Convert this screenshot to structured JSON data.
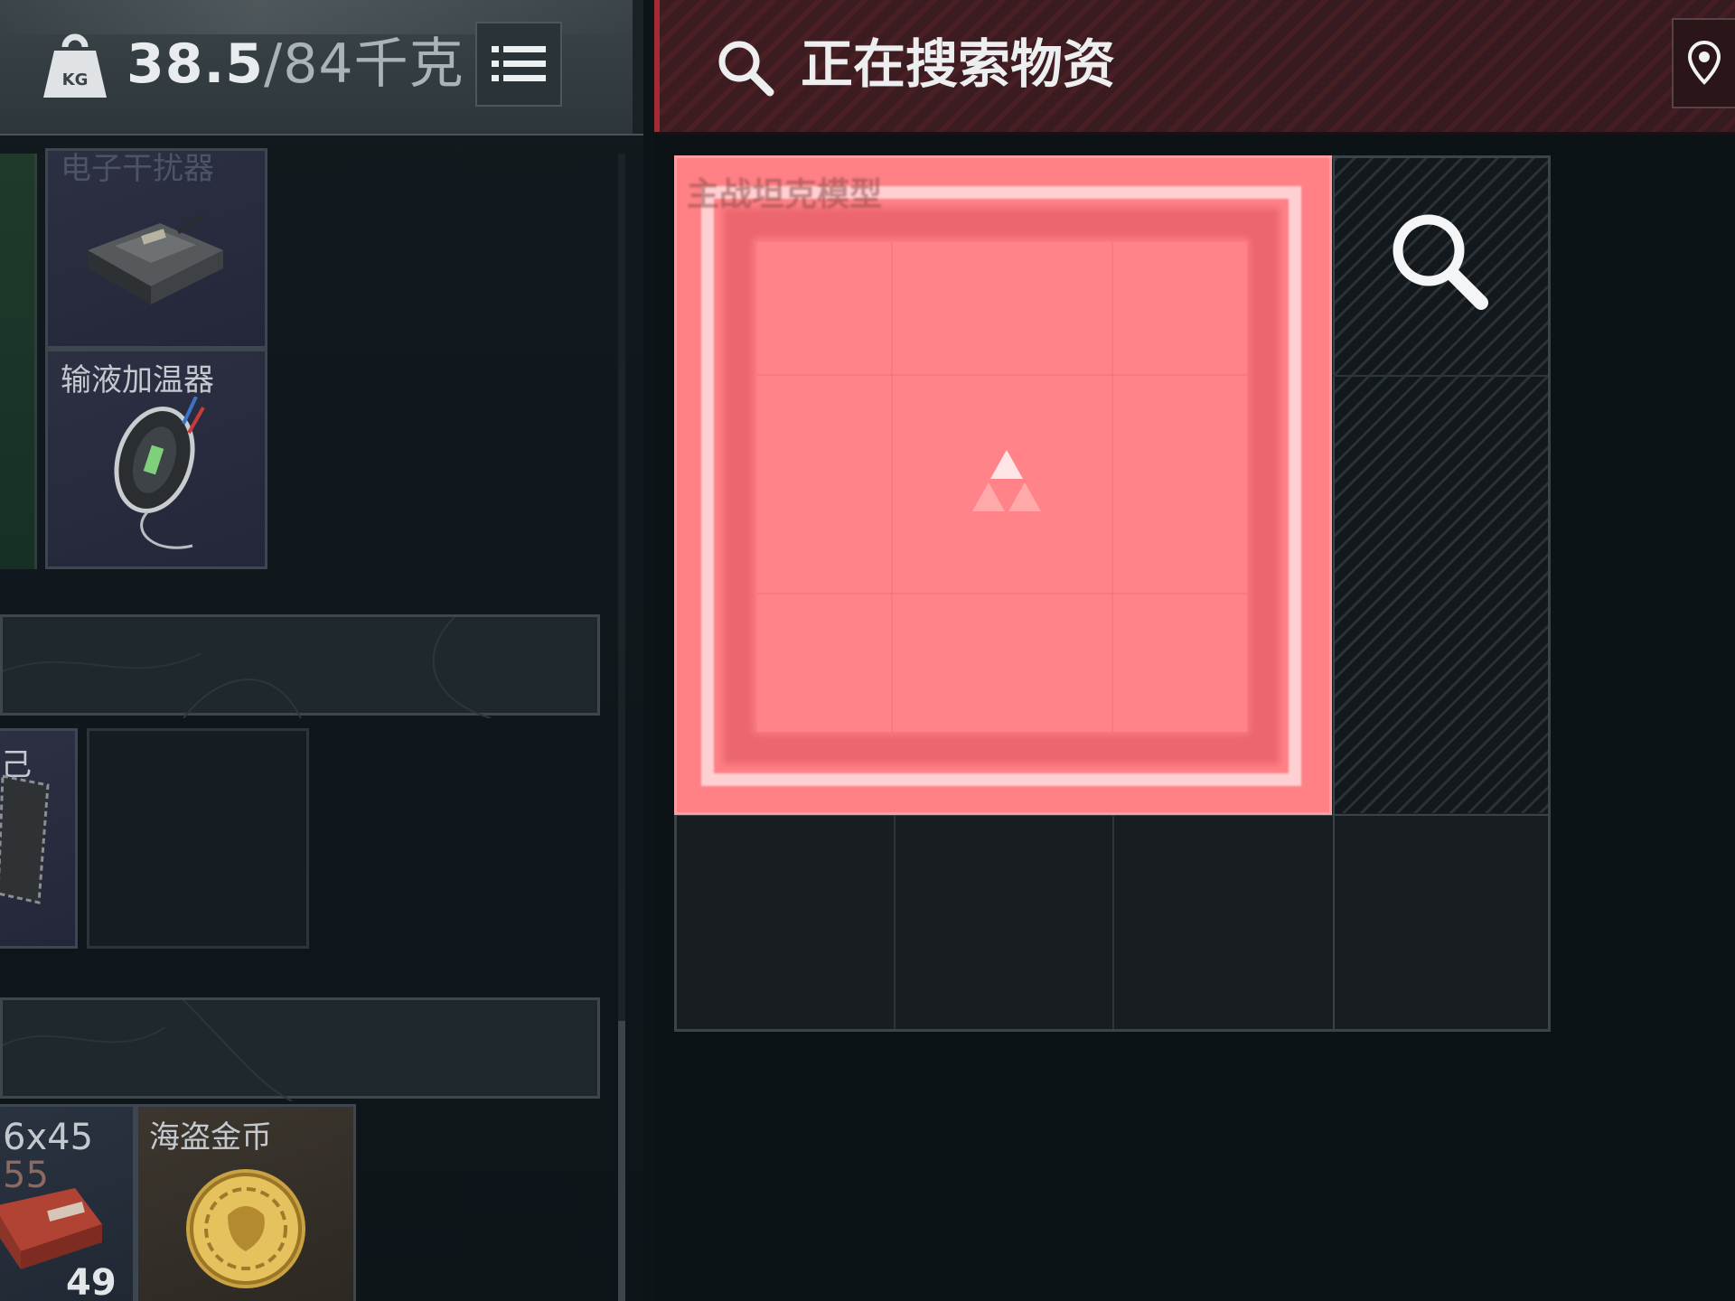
{
  "left": {
    "weight": {
      "current": "38.5",
      "capacity": "/84千克"
    },
    "kg_icon_text": "KG",
    "items": [
      {
        "label": "电子干扰器",
        "faded": true
      },
      {
        "label": "输液加温器",
        "faded": false
      },
      {
        "label": "海盗金币",
        "faded": false
      }
    ],
    "ammo": {
      "label_line1": "6x45",
      "label_line2": "55",
      "count": "49"
    },
    "partial_text": "己"
  },
  "right": {
    "header_title": "正在搜索物资",
    "pink_item_label": "主战坦克模型"
  },
  "colors": {
    "pink_item": "#ff8186",
    "header_red": "#3d1c21",
    "accent_red": "#a42a33"
  },
  "icons": [
    "kg-weight-icon",
    "list-menu-icon",
    "search-icon",
    "location-pin-icon",
    "magnifier-icon",
    "rank-triangle-icon"
  ]
}
